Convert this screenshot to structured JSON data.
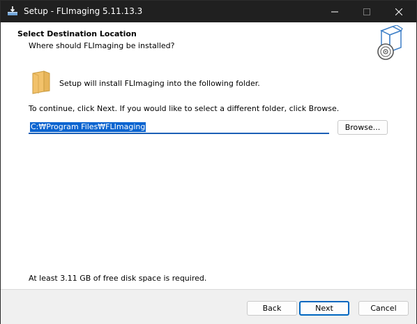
{
  "window": {
    "title": "Setup - FLImaging 5.11.13.3",
    "icon": "installer-icon"
  },
  "header": {
    "title": "Select Destination Location",
    "subtitle": "Where should FLImaging be installed?",
    "icon": "setup-box-disc-icon"
  },
  "body": {
    "intro": "Setup will install FLImaging into the following folder.",
    "instructions": "To continue, click Next. If you would like to select a different folder, click Browse.",
    "path_value": "C:₩Program Files₩FLImaging",
    "browse_label": "Browse...",
    "disk_space": "At least 3.11 GB of free disk space is required."
  },
  "footer": {
    "back_label": "Back",
    "next_label": "Next",
    "cancel_label": "Cancel"
  },
  "colors": {
    "titlebar": "#202020",
    "accent": "#0067c0",
    "selection": "#0a64d0"
  }
}
